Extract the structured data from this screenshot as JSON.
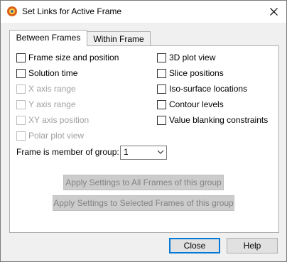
{
  "window": {
    "title": "Set Links for Active Frame"
  },
  "tabs": [
    {
      "label": "Between Frames"
    },
    {
      "label": "Within Frame"
    }
  ],
  "left_checks": [
    {
      "label": "Frame size and position",
      "enabled": true
    },
    {
      "label": "Solution time",
      "enabled": true
    },
    {
      "label": "X axis range",
      "enabled": false
    },
    {
      "label": "Y axis range",
      "enabled": false
    },
    {
      "label": "XY axis position",
      "enabled": false
    },
    {
      "label": "Polar plot view",
      "enabled": false
    }
  ],
  "right_checks": [
    {
      "label": "3D plot view",
      "enabled": true
    },
    {
      "label": "Slice positions",
      "enabled": true
    },
    {
      "label": "Iso-surface locations",
      "enabled": true
    },
    {
      "label": "Contour levels",
      "enabled": true
    },
    {
      "label": "Value blanking constraints",
      "enabled": true
    }
  ],
  "group": {
    "label": "Frame is member of group:",
    "value": "1"
  },
  "apply_all_label": "Apply Settings to All Frames of this group",
  "apply_selected_label": "Apply Settings to Selected Frames of this group",
  "footer": {
    "close_label": "Close",
    "help_label": "Help"
  },
  "icons": {
    "app": "app-icon",
    "close": "close-icon",
    "dropdown": "chevron-down-icon"
  }
}
